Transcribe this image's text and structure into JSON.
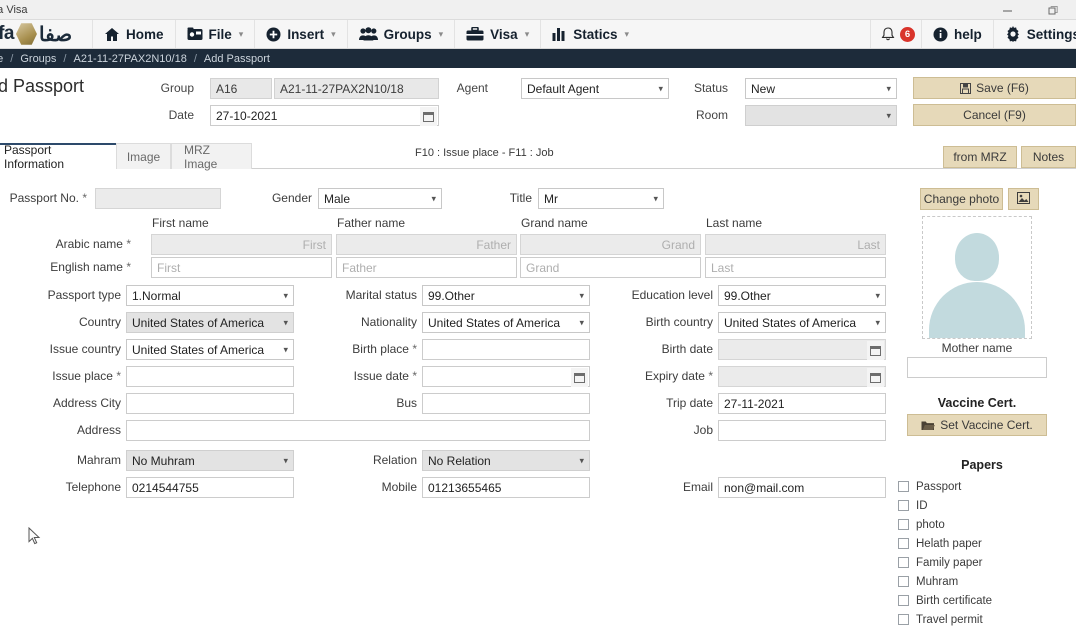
{
  "window": {
    "app_title": "afa Visa",
    "minimize": "─",
    "maximize": "❐",
    "controls_name": "window-controls"
  },
  "brand": {
    "latin": "afa",
    "arabic": "صفا"
  },
  "menubar": {
    "items": [
      {
        "label": "Home",
        "icon": "home-icon",
        "caret": false
      },
      {
        "label": "File",
        "icon": "folder-icon",
        "caret": true
      },
      {
        "label": "Insert",
        "icon": "plus-circle-icon",
        "caret": true
      },
      {
        "label": "Groups",
        "icon": "people-icon",
        "caret": true
      },
      {
        "label": "Visa",
        "icon": "briefcase-icon",
        "caret": true
      },
      {
        "label": "Statics",
        "icon": "bar-chart-icon",
        "caret": true
      }
    ],
    "right": {
      "bell_icon": "bell-icon",
      "badge_count": "6",
      "help_label": "help",
      "help_icon": "info-circle-icon",
      "settings_label": "Settings",
      "settings_icon": "gear-icon"
    }
  },
  "breadcrumb": {
    "items": [
      "me",
      "Groups",
      "A21-11-27PAX2N10/18",
      "Add Passport"
    ],
    "separator": "/"
  },
  "header": {
    "page_title": "dd Passport",
    "group_label": "Group",
    "group_code": "A16",
    "group_name": "A21-11-27PAX2N10/18",
    "date_label": "Date",
    "date_value": "27-10-2021",
    "agent_label": "Agent",
    "agent_value": "Default Agent",
    "status_label": "Status",
    "status_value": "New",
    "room_label": "Room",
    "room_value": "",
    "save_label": "Save (F6)",
    "cancel_label": "Cancel (F9)"
  },
  "tabs": {
    "items": [
      {
        "label": "Passport Information",
        "active": true
      },
      {
        "label": "Image",
        "active": false
      },
      {
        "label": "MRZ Image",
        "active": false
      }
    ],
    "hint": "F10 : Issue place - F11 : Job",
    "from_mrz_label": "from MRZ",
    "notes_label": "Notes"
  },
  "form": {
    "passport_no_label": "Passport No.",
    "passport_no_value": "",
    "gender_label": "Gender",
    "gender_value": "Male",
    "title_label": "Title",
    "title_value": "Mr",
    "name_columns": [
      "First name",
      "Father name",
      "Grand name",
      "Last name"
    ],
    "arabic_name_label": "Arabic name",
    "english_name_label": "English name",
    "arabic_placeholders": [
      "First",
      "Father",
      "Grand",
      "Last"
    ],
    "english_placeholders": [
      "First",
      "Father",
      "Grand",
      "Last"
    ],
    "passport_type_label": "Passport type",
    "passport_type_value": "1.Normal",
    "marital_status_label": "Marital status",
    "marital_status_value": "99.Other",
    "education_level_label": "Education level",
    "education_level_value": "99.Other",
    "country_label": "Country",
    "country_value": "United States of America",
    "nationality_label": "Nationality",
    "nationality_value": "United States of America",
    "birth_country_label": "Birth country",
    "birth_country_value": "United States of America",
    "issue_country_label": "Issue country",
    "issue_country_value": "United States of America",
    "birth_place_label": "Birth place",
    "birth_place_value": "",
    "birth_date_label": "Birth date",
    "birth_date_value": "",
    "issue_place_label": "Issue place",
    "issue_place_value": "",
    "issue_date_label": "Issue date",
    "issue_date_value": "",
    "expiry_date_label": "Expiry date",
    "expiry_date_value": "",
    "address_city_label": "Address City",
    "address_city_value": "",
    "bus_label": "Bus",
    "bus_value": "",
    "trip_date_label": "Trip date",
    "trip_date_value": "27-11-2021",
    "address_label": "Address",
    "address_value": "",
    "job_label": "Job",
    "job_value": "",
    "mahram_label": "Mahram",
    "mahram_value": "No Muhram",
    "relation_label": "Relation",
    "relation_value": "No Relation",
    "telephone_label": "Telephone",
    "telephone_value": "0214544755",
    "mobile_label": "Mobile",
    "mobile_value": "01213655465",
    "email_label": "Email",
    "email_value": "non@mail.com",
    "required_mark": "*"
  },
  "photo_panel": {
    "change_photo_label": "Change photo",
    "photo_browse_icon": "image-icon",
    "avatar_icon": "person-placeholder-icon",
    "mother_name_label": "Mother name",
    "mother_name_value": "",
    "vaccine_cert_title": "Vaccine Cert.",
    "set_vaccine_label": "Set Vaccine Cert.",
    "set_vaccine_icon": "folder-open-icon",
    "papers_title": "Papers",
    "papers": [
      "Passport",
      "ID",
      "photo",
      "Helath paper",
      "Family paper",
      "Muhram",
      "Birth certificate",
      "Travel permit"
    ]
  },
  "colors": {
    "accent": "#1d2b3a",
    "gold": "#e6d9b9",
    "badge_red": "#d9342b"
  }
}
